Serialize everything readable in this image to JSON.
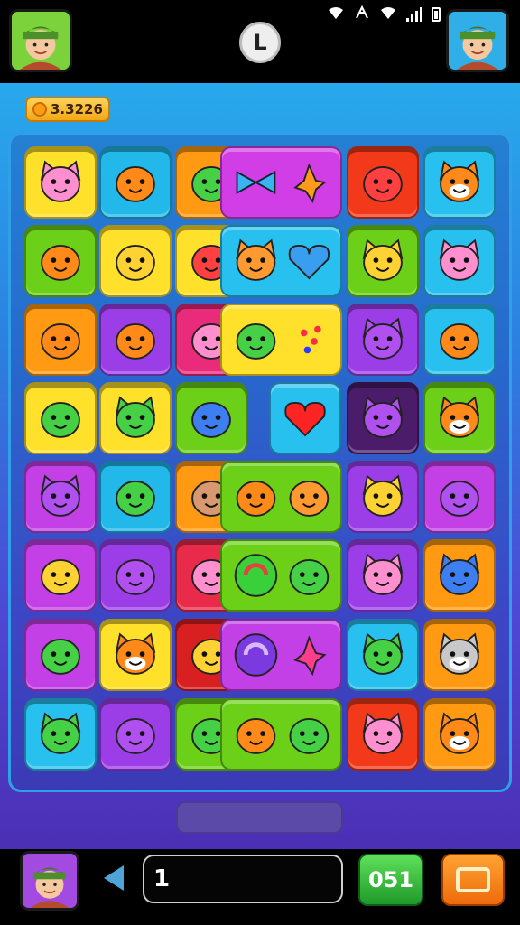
{
  "status_bar": {
    "signal": "signal-icon",
    "wifi": "wifi-icon",
    "battery": "battery-icon"
  },
  "header": {
    "left_avatar": "player-avatar-icon",
    "right_avatar": "opponent-avatar-icon",
    "center_badge": "L"
  },
  "coins": {
    "value": "3.3226",
    "icon": "coin-icon"
  },
  "board": {
    "columns": 6,
    "rows": 8,
    "tiles": [
      [
        "pink-cat",
        "orange-blob",
        "green-leaf",
        "",
        "red-smiley",
        "orange-cat"
      ],
      [
        "orange-creature",
        "yellow-smiley",
        "red-swirl",
        "",
        "yellow-dog",
        "pink-cat"
      ],
      [
        "orange-ball",
        "orange-swirl",
        "pink-swirl",
        "",
        "purple-cat",
        "orange-fish"
      ],
      [
        "green-chevrons",
        "green-cat",
        "blue-blob",
        "",
        "purple-cat",
        "orange-cat"
      ],
      [
        "purple-cat",
        "green-diamond",
        "tan-pig",
        "",
        "yellow-cat",
        "purple-blob"
      ],
      [
        "yellow-smiley",
        "purple-blob",
        "pink-blob",
        "",
        "pink-cat",
        "blue-cat"
      ],
      [
        "green-magnifier",
        "orange-fox",
        "yellow-smiley",
        "",
        "green-cat",
        "grey-cat"
      ],
      [
        "green-cat",
        "purple-blob",
        "green-creature",
        "",
        "pink-cat",
        "orange-fox"
      ]
    ],
    "tile_colors": [
      [
        "#ffe02a",
        "#22b8ea",
        "#ff9a12",
        "",
        "#f23a1a",
        "#28c0ee"
      ],
      [
        "#6cd018",
        "#ffe02a",
        "#ffe02a",
        "",
        "#6cd018",
        "#28c0ee"
      ],
      [
        "#ff9a12",
        "#9c3ee8",
        "#ea2a7a",
        "",
        "#9c3ee8",
        "#28c0ee"
      ],
      [
        "#ffe02a",
        "#ffe02a",
        "#6cd018",
        "",
        "#4a1c6a",
        "#6cd018"
      ],
      [
        "#c240e6",
        "#22b8ea",
        "#ff9a12",
        "",
        "#9c3ee8",
        "#c240e6"
      ],
      [
        "#c240e6",
        "#9c3ee8",
        "#ea2a4a",
        "",
        "#9c3ee8",
        "#ff9a12"
      ],
      [
        "#c240e6",
        "#ffe02a",
        "#d82020",
        "",
        "#28c0ee",
        "#ff9a12"
      ],
      [
        "#28c0ee",
        "#9c3ee8",
        "#6cd018",
        "",
        "#f23a1a",
        "#ff9a12"
      ]
    ],
    "wide_tiles": [
      {
        "color": "#d23ee6",
        "icons": [
          "blue-bow-icon",
          "orange-flame-icon"
        ]
      },
      {
        "color": "#28c0ee",
        "icons": [
          "cat-face-icon",
          "blue-heart-icon"
        ]
      },
      {
        "color": "#ffe02a",
        "icons": [
          "green-turtle-icon",
          "red-dots-icon"
        ]
      },
      {
        "color": "#28c0ee",
        "icons": [
          "red-heart-icon"
        ]
      },
      {
        "color": "#6cd018",
        "icons": [
          "orange-face-icon",
          "chick-icon"
        ]
      },
      {
        "color": "#6cd018",
        "icons": [
          "green-swirl-icon",
          "green-bug-icon"
        ]
      },
      {
        "color": "#c240e6",
        "icons": [
          "purple-spiral-icon",
          "pink-star-icon"
        ]
      },
      {
        "color": "#6cd018",
        "icons": [
          "orange-ear-icon",
          "green-alien-icon"
        ]
      }
    ]
  },
  "bottom": {
    "avatar": "player-avatar-icon",
    "back": "back-arrow-icon",
    "input_value": "1",
    "green_button": "051",
    "orange_button": "menu-icon"
  }
}
